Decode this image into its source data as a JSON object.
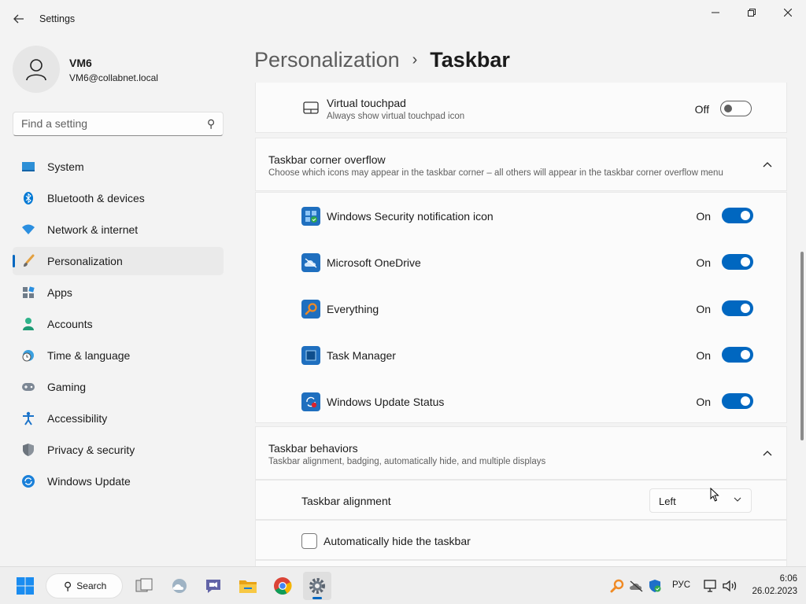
{
  "window": {
    "title": "Settings",
    "back_icon": "arrow-left-icon",
    "minimize_icon": "minimize-icon",
    "maximize_icon": "restore-icon",
    "close_icon": "close-icon"
  },
  "profile": {
    "name": "VM6",
    "email": "VM6@collabnet.local",
    "avatar_icon": "user-avatar-icon"
  },
  "search": {
    "placeholder": "Find a setting",
    "icon": "search-icon"
  },
  "nav": {
    "active": "Personalization",
    "accent_color": "#0067c0",
    "items": [
      {
        "label": "System",
        "icon": "monitor-icon"
      },
      {
        "label": "Bluetooth & devices",
        "icon": "bluetooth-icon"
      },
      {
        "label": "Network & internet",
        "icon": "wifi-icon"
      },
      {
        "label": "Personalization",
        "icon": "brush-icon"
      },
      {
        "label": "Apps",
        "icon": "apps-icon"
      },
      {
        "label": "Accounts",
        "icon": "person-icon"
      },
      {
        "label": "Time & language",
        "icon": "clock-globe-icon"
      },
      {
        "label": "Gaming",
        "icon": "gamepad-icon"
      },
      {
        "label": "Accessibility",
        "icon": "accessibility-icon"
      },
      {
        "label": "Privacy & security",
        "icon": "shield-icon"
      },
      {
        "label": "Windows Update",
        "icon": "update-icon"
      }
    ]
  },
  "breadcrumb": {
    "parent": "Personalization",
    "separator": "›",
    "current": "Taskbar"
  },
  "virtual_touchpad": {
    "title": "Virtual touchpad",
    "description": "Always show virtual touchpad icon",
    "state": "Off",
    "icon": "touchpad-icon"
  },
  "corner_overflow": {
    "title": "Taskbar corner overflow",
    "description": "Choose which icons may appear in the taskbar corner – all others will appear in the taskbar corner overflow menu",
    "chevron": "chevron-up-icon",
    "items": [
      {
        "label": "Windows Security notification icon",
        "state": "On",
        "icon": "windows-security-icon"
      },
      {
        "label": "Microsoft OneDrive",
        "state": "On",
        "icon": "onedrive-icon"
      },
      {
        "label": "Everything",
        "state": "On",
        "icon": "everything-search-icon"
      },
      {
        "label": "Task Manager",
        "state": "On",
        "icon": "task-manager-icon"
      },
      {
        "label": "Windows Update Status",
        "state": "On",
        "icon": "windows-update-status-icon"
      }
    ]
  },
  "behaviors": {
    "title": "Taskbar behaviors",
    "description": "Taskbar alignment, badging, automatically hide, and multiple displays",
    "chevron": "chevron-up-icon",
    "alignment_label": "Taskbar alignment",
    "alignment_value": "Left",
    "auto_hide_label": "Automatically hide the taskbar",
    "auto_hide_checked": false
  },
  "taskbar": {
    "search_label": "Search",
    "apps": [
      "windows-start-icon",
      "task-view-icon",
      "weather-icon",
      "teams-chat-icon",
      "file-explorer-icon",
      "chrome-icon",
      "settings-gear-icon"
    ],
    "tray_icons": [
      "everything-tray-icon",
      "onedrive-tray-icon",
      "defender-tray-icon"
    ],
    "language": "РУС",
    "network_icon": "network-icon",
    "volume_icon": "volume-icon",
    "time": "6:06",
    "date": "26.02.2023"
  }
}
